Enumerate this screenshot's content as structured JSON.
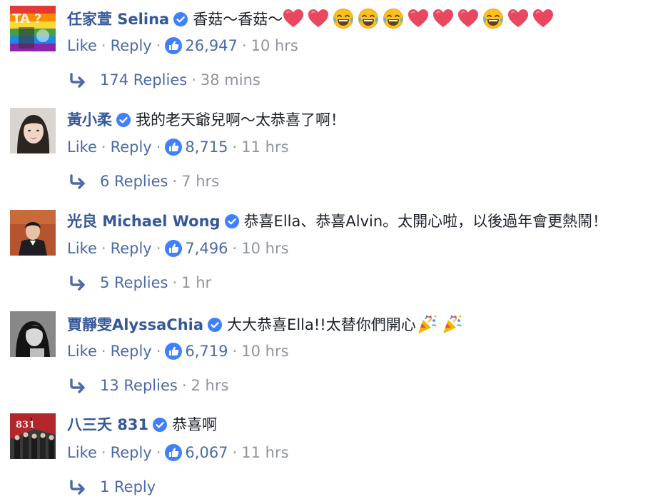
{
  "comments": [
    {
      "author": "任家萱 Selina",
      "text": "香菇～香菇～",
      "emojis": [
        "heart-icon",
        "heart-icon",
        "laugh-cry-icon",
        "laugh-cry-icon",
        "laugh-cry-icon",
        "heart-icon",
        "heart-icon",
        "heart-icon",
        "laugh-cry-icon",
        "heart-icon",
        "heart-icon"
      ],
      "like_label": "Like",
      "reply_label": "Reply",
      "likes": "26,947",
      "time": "10 hrs",
      "replies": "174 Replies",
      "replies_time": "38 mins"
    },
    {
      "author": "黃小柔",
      "text": "我的老天爺兒啊～太恭喜了啊！",
      "emojis": [],
      "like_label": "Like",
      "reply_label": "Reply",
      "likes": "8,715",
      "time": "11 hrs",
      "replies": "6 Replies",
      "replies_time": "7 hrs"
    },
    {
      "author": "光良 Michael Wong",
      "text": "恭喜Ella、恭喜Alvin。太開心啦，以後過年會更熱鬧！",
      "emojis": [],
      "like_label": "Like",
      "reply_label": "Reply",
      "likes": "7,496",
      "time": "10 hrs",
      "replies": "5 Replies",
      "replies_time": "1 hr"
    },
    {
      "author": "賈靜雯AlyssaChia",
      "text": "大大恭喜Ella!!太替你們開心",
      "emojis": [
        "party-popper-icon",
        "party-popper-icon"
      ],
      "like_label": "Like",
      "reply_label": "Reply",
      "likes": "6,719",
      "time": "10 hrs",
      "replies": "13 Replies",
      "replies_time": "2 hrs"
    },
    {
      "author": "八三夭 831",
      "text": "恭喜啊",
      "emojis": [],
      "like_label": "Like",
      "reply_label": "Reply",
      "likes": "6,067",
      "time": "11 hrs",
      "replies": "1 Reply",
      "replies_time": ""
    }
  ],
  "colors": {
    "author": "#365899",
    "action": "#4b6aa6",
    "meta": "#90949c",
    "verified": "#4080ff",
    "heart": "#e8475f"
  }
}
